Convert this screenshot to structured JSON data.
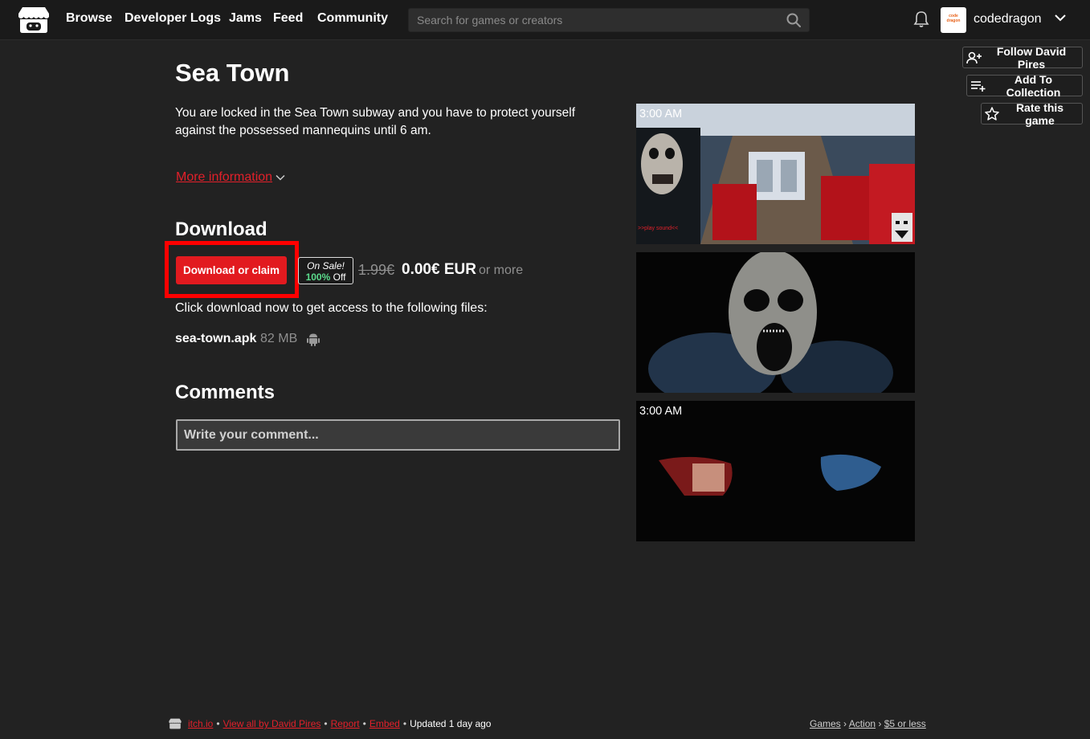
{
  "nav": {
    "links": [
      "Browse",
      "Developer Logs",
      "Jams",
      "Feed",
      "Community"
    ],
    "search_placeholder": "Search for games or creators",
    "avatar_text": "code dragon",
    "username": "codedragon"
  },
  "actions": {
    "follow": "Follow David Pires",
    "collection": "Add To Collection",
    "rate": "Rate this game"
  },
  "game": {
    "title": "Sea Town",
    "description": "You are locked in the Sea Town subway and you have to protect yourself against the possessed mannequins until 6 am.",
    "more_info": "More information"
  },
  "download": {
    "heading": "Download",
    "button": "Download or claim",
    "sale_top": "On Sale!",
    "sale_pct": "100%",
    "sale_off": "Off",
    "old_price": "1.99€",
    "new_price": "0.00€ EUR",
    "or_more": "or more",
    "instruction": "Click download now to get access to the following files:",
    "file_name": "sea-town.apk",
    "file_size": "82 MB"
  },
  "comments": {
    "heading": "Comments",
    "placeholder": "Write your comment..."
  },
  "screenshots": [
    {
      "label": "3:00 AM",
      "overlay": ">>play sound<<"
    },
    {
      "label": ""
    },
    {
      "label": "3:00 AM"
    }
  ],
  "footer": {
    "site": "itch.io",
    "view_all": "View all by David Pires",
    "report": "Report",
    "embed": "Embed",
    "updated": "Updated 1 day ago",
    "crumbs": [
      "Games",
      "Action",
      "$5 or less"
    ]
  },
  "colors": {
    "accent": "#e21a1f",
    "sale_green": "#5bdb8c",
    "highlight": "#ff0000"
  }
}
